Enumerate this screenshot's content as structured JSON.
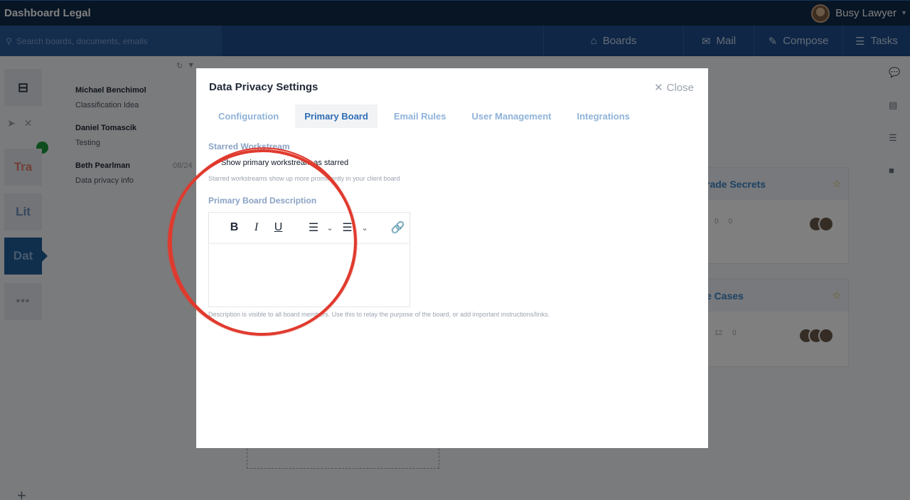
{
  "app": {
    "title": "Dashboard Legal",
    "user_name": "Busy Lawyer",
    "caret": "▾"
  },
  "nav": {
    "search_placeholder": "Search boards, documents, emails",
    "items": [
      {
        "label": "Boards",
        "icon": "home-icon"
      },
      {
        "label": "Mail",
        "icon": "mail-icon"
      },
      {
        "label": "Compose",
        "icon": "pencil-icon"
      },
      {
        "label": "Tasks",
        "icon": "list-icon"
      }
    ]
  },
  "rail": {
    "tiles": [
      "Tra",
      "Lit",
      "Dat",
      "•••"
    ],
    "add": "+"
  },
  "emails": [
    {
      "from": "Michael Benchimol",
      "subject": "Classification Idea",
      "date": ""
    },
    {
      "from": "Daniel Tomascik",
      "subject": "Testing",
      "date": ""
    },
    {
      "from": "Beth Pearlman",
      "subject": "Data privacy info",
      "date": "08/24"
    }
  ],
  "cards": [
    {
      "name": "rade Secrets",
      "stats": [
        "0",
        "0"
      ]
    },
    {
      "name": "e Cases",
      "stats": [
        "12",
        "0"
      ]
    }
  ],
  "modal": {
    "title": "Data Privacy Settings",
    "close_label": "Close",
    "tabs": [
      "Configuration",
      "Primary Board",
      "Email Rules",
      "User Management",
      "Integrations"
    ],
    "active_tab": "Primary Board",
    "starred_section": "Starred Workstream",
    "starred_checkbox_label": "Show primary workstream as starred",
    "starred_help": "Starred workstreams show up more prominently in your client board",
    "description_section": "Primary Board Description",
    "description_help": "Description is visible to all board members. Use this to relay the purpose of the board, or add important instructions/links.",
    "editor_value": "",
    "toolbar": {
      "bold": "B",
      "italic": "I",
      "underline": "U"
    }
  },
  "colors": {
    "topbar": "#0f2a4a",
    "navbar": "#1e4d8c",
    "accent": "#2f6db5",
    "annotation": "#e03a2e"
  }
}
